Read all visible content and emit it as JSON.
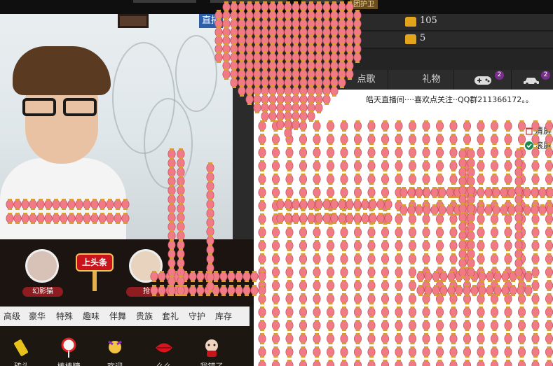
{
  "header": {
    "guard_badge": "团护卫",
    "live_tag": "直播"
  },
  "stats": [
    {
      "icon": "gold-coin-icon",
      "value": "105"
    },
    {
      "icon": "gold-coin-icon",
      "value": "5"
    }
  ],
  "tabs": [
    {
      "label": "点歌",
      "icon": ""
    },
    {
      "label": "礼物",
      "icon": ""
    },
    {
      "label": "",
      "icon": "gamepad-icon",
      "badge": "2"
    },
    {
      "label": "",
      "icon": "car-icon",
      "badge": "2"
    }
  ],
  "chat": {
    "announcement": "皓天直播间····喜欢点关注··QQ群211366172。。",
    "clear_label": "清屏",
    "scroll_label": "滚屏"
  },
  "lower_panel": {
    "slots": [
      {
        "name": "幻影猫",
        "icon": "avatar-icon"
      },
      {
        "name": "抢",
        "icon": "default-avatar-icon"
      }
    ],
    "headline_label": "上头条"
  },
  "gift_categories": [
    "高级",
    "豪华",
    "特殊",
    "趣味",
    "伴舞",
    "贵族",
    "套礼",
    "守护",
    "库存"
  ],
  "gifts": [
    {
      "label": "砖头",
      "icon": "brick-icon"
    },
    {
      "label": "棒棒糖",
      "icon": "lollipop-icon"
    },
    {
      "label": "欢迎",
      "icon": "welcome-icon"
    },
    {
      "label": "么么",
      "icon": "kiss-lips-icon"
    },
    {
      "label": "我错了",
      "icon": "sorry-doll-icon"
    }
  ],
  "colors": {
    "lantern": "#f07a86",
    "lantern_cap": "#d4a22a",
    "live_tag": "#2f5ea8",
    "coin": "#e3a31b"
  }
}
